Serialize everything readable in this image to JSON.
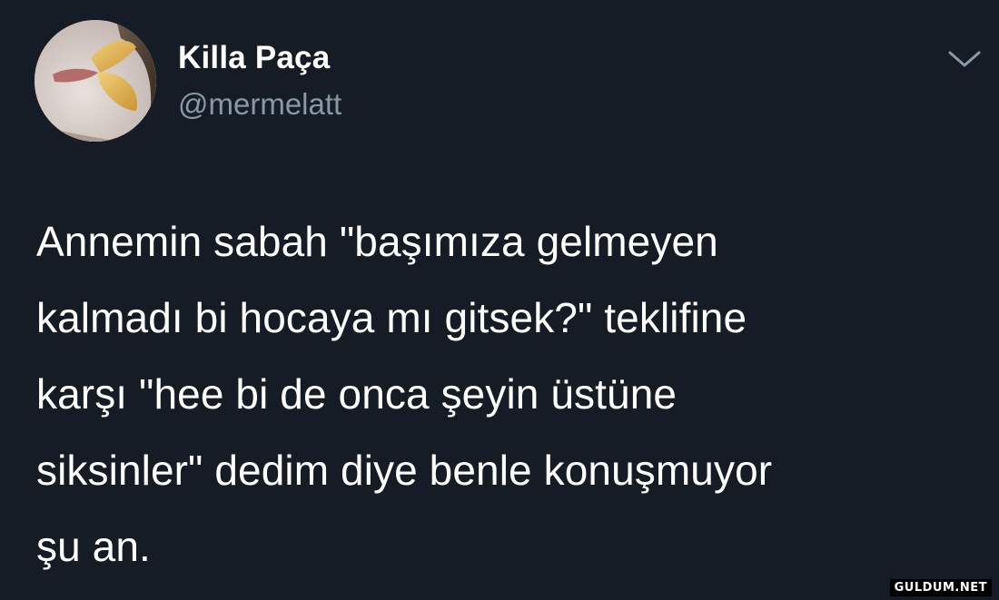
{
  "author": {
    "display_name": "Killa Paça",
    "handle": "@mermelatt",
    "avatar": "profile-photo"
  },
  "menu": {
    "icon": "chevron-down-icon"
  },
  "tweet": {
    "text": "Annemin sabah \"başımıza gelmeyen\nkalmadı bi hocaya mı gitsek?\" teklifine\nkarşı \"hee bi de onca şeyin üstüne\nsiksinler\" dedim diye benle konuşmuyor\nşu an."
  },
  "watermark": {
    "text": "GULDUM.NET"
  },
  "colors": {
    "background": "#161c25",
    "name": "#ffffff",
    "handle": "#8899a6",
    "text": "#ffffff",
    "icon": "#8899a6"
  }
}
